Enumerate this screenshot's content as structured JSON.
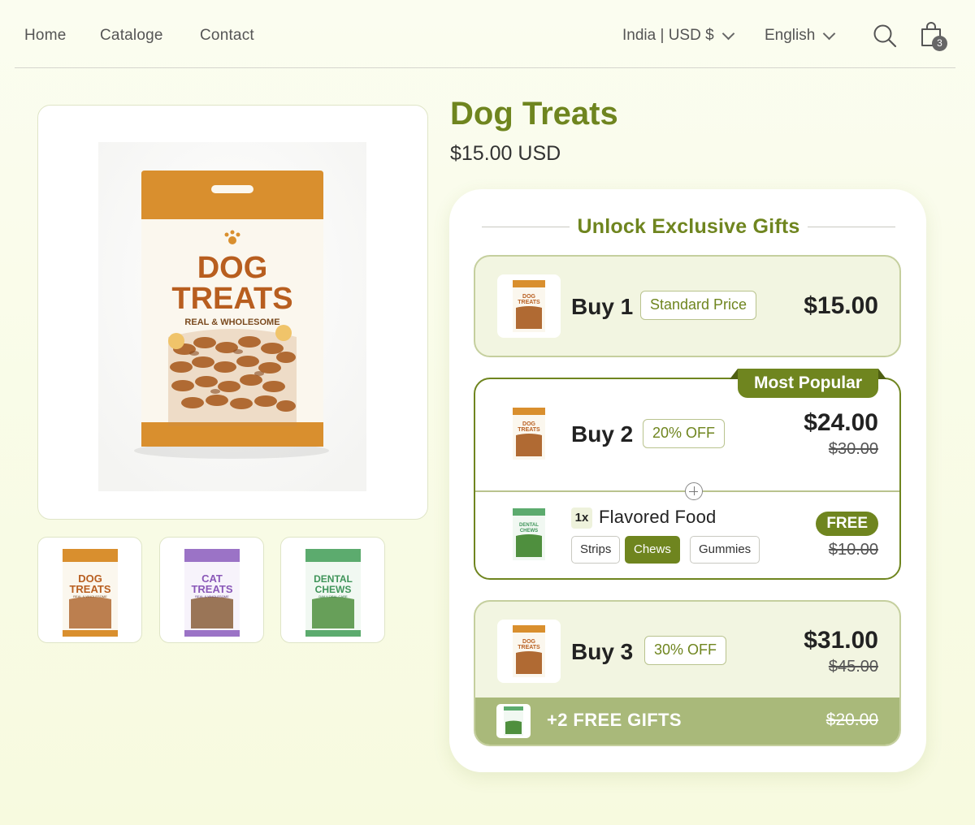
{
  "nav": {
    "links": [
      "Home",
      "Cataloge",
      "Contact"
    ],
    "currency": "India | USD $",
    "language": "English",
    "cart_count": "3"
  },
  "colors": {
    "brand": "#6f851f",
    "dog_pack": "#d98f2e",
    "cat_pack": "#9b73c6",
    "dental_pack": "#5cab6e"
  },
  "gallery": {
    "main_pack": {
      "line1": "DOG",
      "line2": "TREATS",
      "sub": "REAL & WHOLESOME"
    },
    "thumbnails": [
      {
        "line1": "DOG",
        "line2": "TREATS",
        "sub": "REAL & WHOLESOME"
      },
      {
        "line1": "CAT",
        "line2": "TREATS",
        "sub": "REAL & WHOLESOME"
      },
      {
        "line1": "DENTAL",
        "line2": "CHEWS",
        "sub": "DAILY ORAL CARE"
      }
    ]
  },
  "product": {
    "title": "Dog Treats",
    "price": "$15.00 USD"
  },
  "bundle": {
    "heading": "Unlock Exclusive Gifts",
    "offers": [
      {
        "label": "Buy 1",
        "tag": "Standard Price",
        "price": "$15.00"
      },
      {
        "label": "Buy 2",
        "tag": "20% OFF",
        "price": "$24.00",
        "compare": "$30.00",
        "badge": "Most Popular",
        "gift": {
          "qty": "1x",
          "name": "Flavored Food",
          "variants": [
            "Strips",
            "Chews",
            "Gummies"
          ],
          "selected": "Chews",
          "price": "FREE",
          "compare": "$10.00"
        }
      },
      {
        "label": "Buy 3",
        "tag": "30% OFF",
        "price": "$31.00",
        "compare": "$45.00",
        "extra": {
          "text": "+2 FREE GIFTS",
          "compare": "$20.00"
        }
      }
    ]
  }
}
